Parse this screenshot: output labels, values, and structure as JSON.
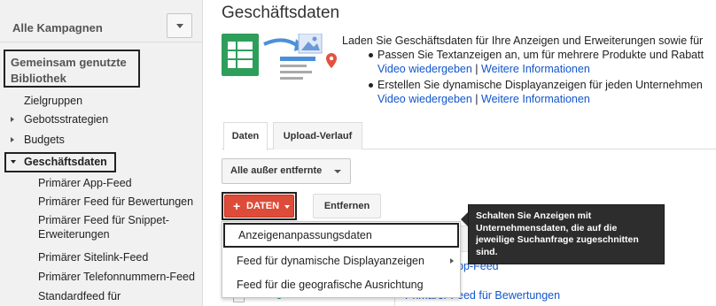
{
  "sidebar": {
    "all_campaigns": "Alle Kampagnen",
    "shared_library": "Gemeinsam genutzte Bibliothek",
    "items": [
      {
        "label": "Zielgruppen"
      },
      {
        "label": "Gebotsstrategien"
      },
      {
        "label": "Budgets"
      },
      {
        "label": "Geschäftsdaten"
      }
    ],
    "sub_items": [
      {
        "label": "Primärer App-Feed"
      },
      {
        "label": "Primärer Feed für Bewertungen"
      },
      {
        "label": "Primärer Feed für Snippet-"
      },
      {
        "label": "Erweiterungen"
      },
      {
        "label": "Primärer Sitelink-Feed"
      },
      {
        "label": "Primärer Telefonnummern-Feed"
      },
      {
        "label": "Standardfeed für"
      }
    ]
  },
  "main": {
    "title": "Geschäftsdaten",
    "intro": "Laden Sie Geschäftsdaten für Ihre Anzeigen und Erweiterungen sowie für",
    "bullets": [
      {
        "text": "Passen Sie Textanzeigen an, um für mehrere Produkte und Rabatt",
        "video": "Video wiedergeben",
        "sep": "|",
        "more": "Weitere Informationen"
      },
      {
        "text": "Erstellen Sie dynamische Displayanzeigen für jeden Unternehmen",
        "video": "Video wiedergeben",
        "sep": "|",
        "more": "Weitere Informationen"
      }
    ],
    "tabs": [
      {
        "label": "Daten"
      },
      {
        "label": "Upload-Verlauf"
      }
    ],
    "filter": "Alle außer entfernte",
    "daten_button": {
      "plus": "+",
      "label": "DATEN"
    },
    "remove_button": "Entfernen",
    "rows": [
      {
        "link": "Primärer App-Feed"
      },
      {
        "link": "Primärer Feed für Bewertungen"
      }
    ]
  },
  "menu": {
    "items": [
      {
        "label": "Anzeigenanpassungsdaten"
      },
      {
        "label": "Feed für dynamische Displayanzeigen"
      },
      {
        "label": "Feed für die geografische Ausrichtung"
      }
    ]
  },
  "tooltip": "Schalten Sie Anzeigen mit Unternehmensdaten, die auf die jeweilige Suchanfrage zugeschnitten sind.",
  "colors": {
    "accent_red": "#dd4b39",
    "link_blue": "#1155cc",
    "status_green": "#0f9d58"
  }
}
